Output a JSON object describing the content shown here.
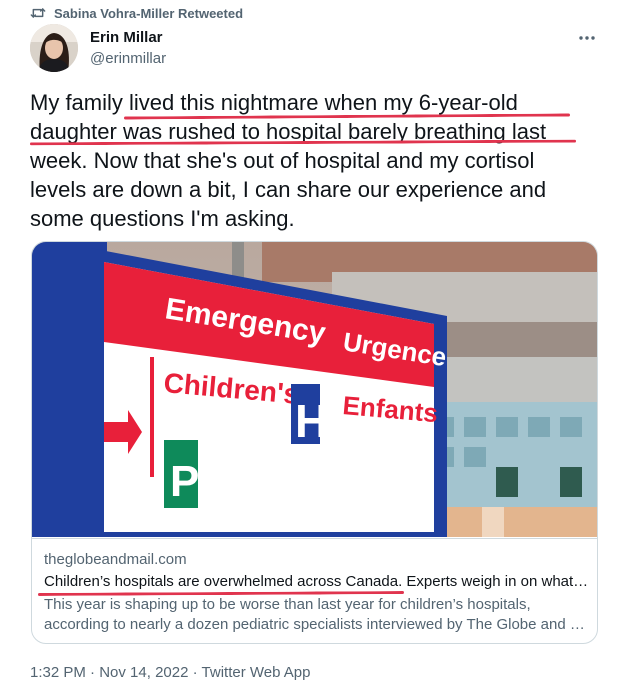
{
  "retweet": {
    "icon": "retweet-icon",
    "label": "Sabina Vohra-Miller Retweeted"
  },
  "author": {
    "name": "Erin Millar",
    "handle": "@erinmillar",
    "avatar": "avatar-photo"
  },
  "more_icon": "more-icon",
  "tweet": {
    "lines": [
      "My family lived this nightmare when my 6-year-old",
      "daughter was rushed to hospital barely breathing last",
      "week. Now that she's out of hospital and my cortisol",
      "levels are down a bit, I can share our experience and",
      "some questions I'm asking."
    ]
  },
  "card": {
    "sign": {
      "emergency": "Emergency",
      "urgence": "Urgence",
      "childrens": "Children's",
      "enfants": "Enfants",
      "h": "H",
      "p": "P"
    },
    "domain": "theglobeandmail.com",
    "title": "Children’s hospitals are overwhelmed across Canada. Experts weigh in on what…",
    "description_lines": [
      "This year is shaping up to be worse than last year for children’s hospitals,",
      "according to nearly a dozen pediatric specialists interviewed by The Globe and …"
    ]
  },
  "meta": {
    "time": "1:32 PM",
    "date": "Nov 14, 2022",
    "client": "Twitter Web App",
    "separator": "·"
  },
  "colors": {
    "annotation_red": "#e0344e",
    "secondary_text": "#536471",
    "sign_red": "#e8203a",
    "sign_blue": "#1f3f9e",
    "sign_green": "#0e8a5a"
  }
}
